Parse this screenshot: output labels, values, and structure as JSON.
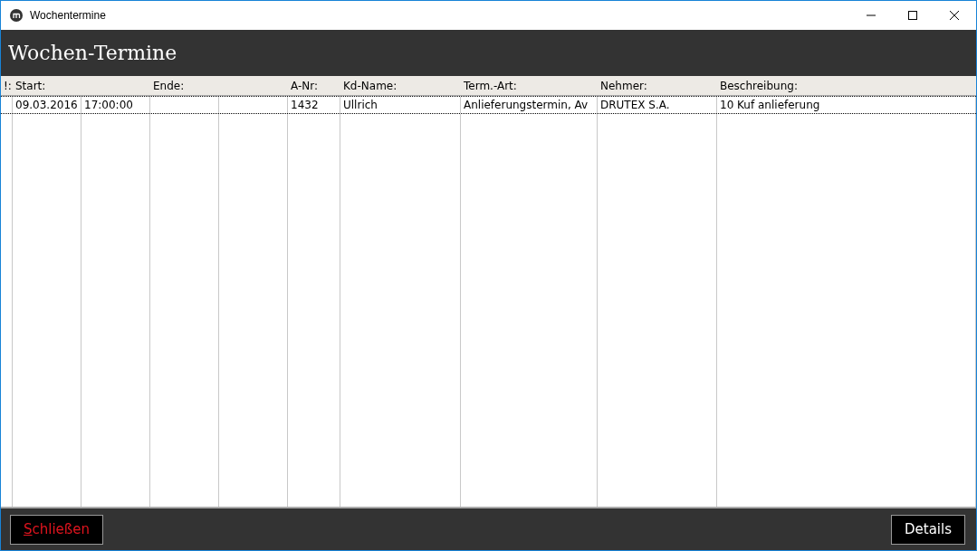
{
  "window": {
    "title": "Wochentermine"
  },
  "header": {
    "title": "Wochen-Termine"
  },
  "table": {
    "columns": [
      "!:",
      "Start:",
      "Ende:",
      "A-Nr:",
      "Kd-Name:",
      "Term.-Art:",
      "Nehmer:",
      "Beschreibung:"
    ],
    "rows": [
      {
        "selected": true,
        "start_date": "09.03.2016",
        "start_time": "17:00:00",
        "a_nr": "1432",
        "kd_name": "Ullrich",
        "term_art": "Anlieferungstermin, Av",
        "nehmer": "DRUTEX S.A.",
        "beschreibung": "10 Kuf anlieferung"
      }
    ]
  },
  "buttons": {
    "close": "Schließen",
    "details": "Details"
  }
}
